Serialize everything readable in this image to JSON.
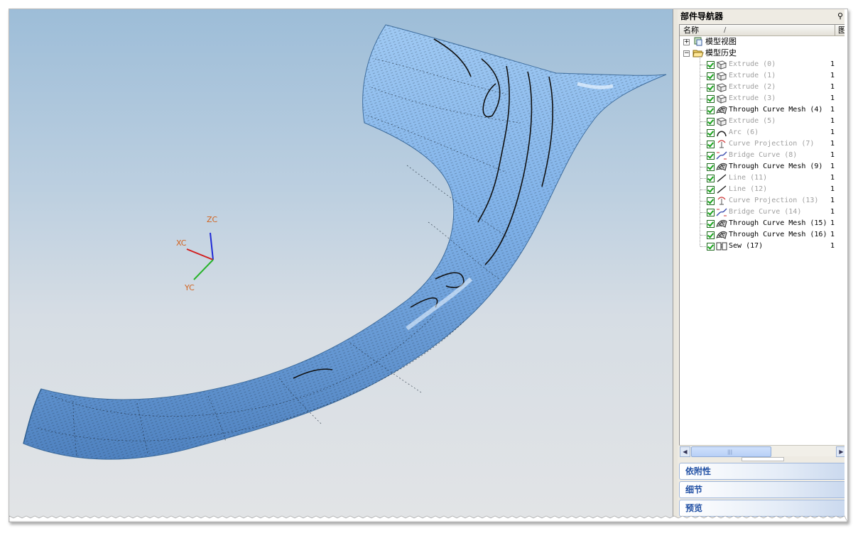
{
  "viewport": {
    "background_top": "#9dbdd8",
    "background_bottom": "#e2e4e6",
    "model_color": "#7fb1e8",
    "triad": {
      "zc": "ZC",
      "xc": "XC",
      "yc": "YC",
      "z_color": "#1f2ad6",
      "x_color": "#d11e1e",
      "y_color": "#27b32a",
      "label_color": "#d2631e"
    }
  },
  "navigator": {
    "title": "部件导航器",
    "pin_icon": "pin-icon",
    "column_name": "名称",
    "column_sort": "/",
    "column_next": "图",
    "top_nodes": [
      {
        "label": "模型视图",
        "expander": "+",
        "icon": "model-views-icon"
      },
      {
        "label": "模型历史",
        "expander": "−",
        "icon": "open-folder-icon"
      }
    ],
    "features": [
      {
        "label": "Extrude (0)",
        "icon": "extrude-icon",
        "state": "dim",
        "trail": "1"
      },
      {
        "label": "Extrude (1)",
        "icon": "extrude-icon",
        "state": "dim",
        "trail": "1"
      },
      {
        "label": "Extrude (2)",
        "icon": "extrude-icon",
        "state": "dim",
        "trail": "1"
      },
      {
        "label": "Extrude (3)",
        "icon": "extrude-icon",
        "state": "dim",
        "trail": "1"
      },
      {
        "label": "Through Curve Mesh (4)",
        "icon": "curve-mesh-icon",
        "state": "bold",
        "trail": "1"
      },
      {
        "label": "Extrude (5)",
        "icon": "extrude-icon",
        "state": "dim",
        "trail": "1"
      },
      {
        "label": "Arc (6)",
        "icon": "arc-icon",
        "state": "dim",
        "trail": "1"
      },
      {
        "label": "Curve Projection (7)",
        "icon": "curve-projection-icon",
        "state": "dim",
        "trail": "1"
      },
      {
        "label": "Bridge Curve (8)",
        "icon": "bridge-curve-icon",
        "state": "dim",
        "trail": "1"
      },
      {
        "label": "Through Curve Mesh (9)",
        "icon": "curve-mesh-icon",
        "state": "bold",
        "trail": "1"
      },
      {
        "label": "Line (11)",
        "icon": "line-icon",
        "state": "dim",
        "trail": "1"
      },
      {
        "label": "Line (12)",
        "icon": "line-icon",
        "state": "dim",
        "trail": "1"
      },
      {
        "label": "Curve Projection (13)",
        "icon": "curve-projection-icon",
        "state": "dim",
        "trail": "1"
      },
      {
        "label": "Bridge Curve (14)",
        "icon": "bridge-curve-icon",
        "state": "dim",
        "trail": "1"
      },
      {
        "label": "Through Curve Mesh (15)",
        "icon": "curve-mesh-icon",
        "state": "bold",
        "trail": "1"
      },
      {
        "label": "Through Curve Mesh (16)",
        "icon": "curve-mesh-icon",
        "state": "bold",
        "trail": "1"
      },
      {
        "label": "Sew (17)",
        "icon": "sew-icon",
        "state": "bold",
        "trail": "1"
      }
    ],
    "panels": [
      {
        "label": "依附性"
      },
      {
        "label": "细节"
      },
      {
        "label": "预览"
      }
    ]
  }
}
